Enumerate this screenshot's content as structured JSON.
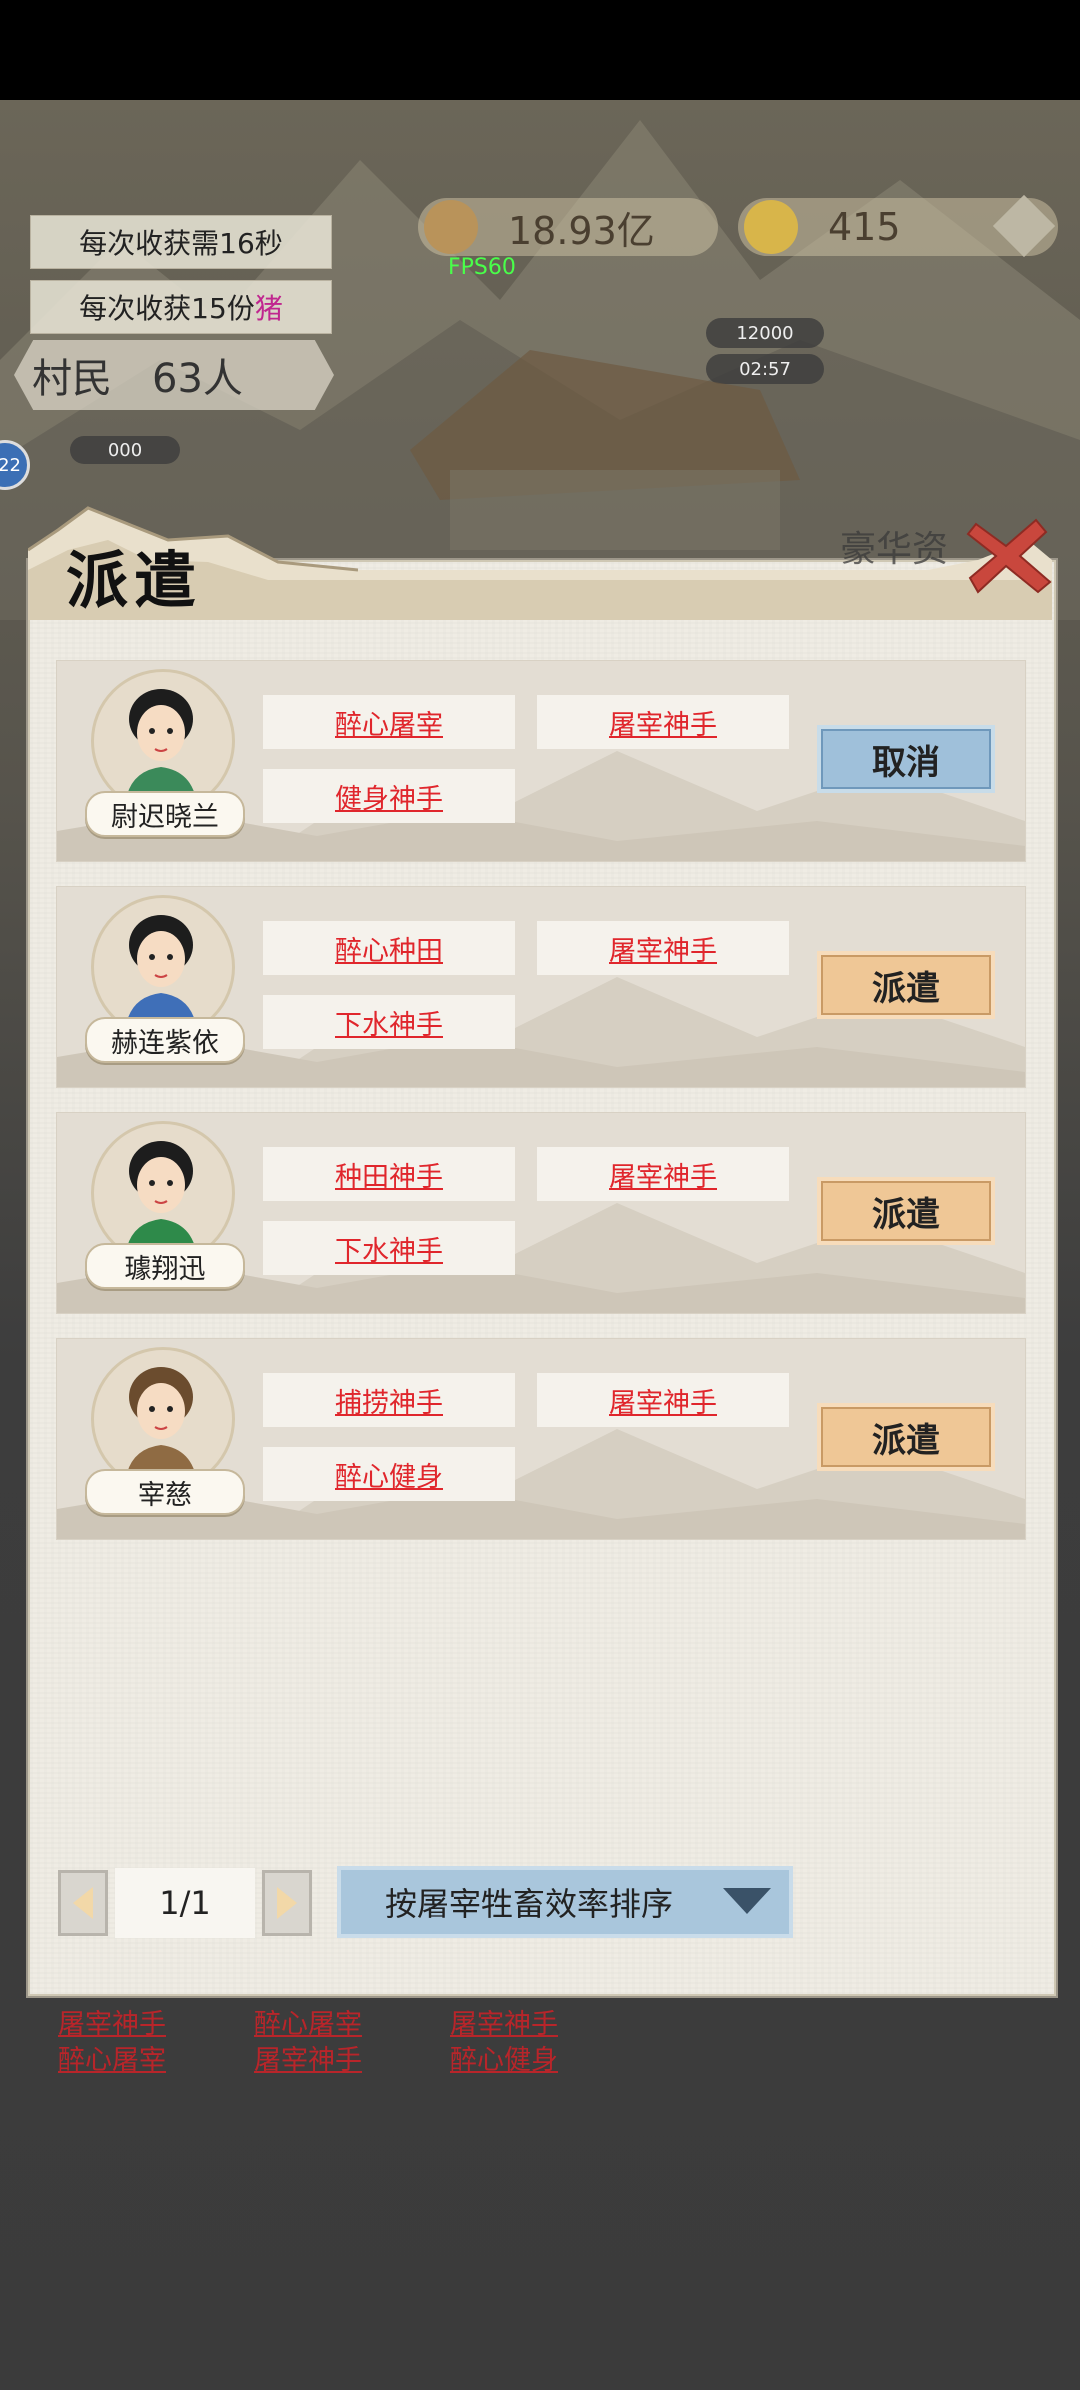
{
  "hud": {
    "harvest_time": "每次收获需16秒",
    "harvest_amount_prefix": "每次收获15份",
    "harvest_amount_item": "猪",
    "coins": "18.93亿",
    "ingots": "415",
    "fps": "FPS60",
    "villagers_label": "村民",
    "villagers_count": "63人",
    "timer_value": "12000",
    "timer_clock": "02:57",
    "side_badge": "22",
    "side_value": "000"
  },
  "panel": {
    "title": "派遣",
    "header_right_text": "豪华资"
  },
  "villagers": [
    {
      "name": "尉迟晓兰",
      "traits": [
        "醉心屠宰",
        "屠宰神手",
        "健身神手"
      ],
      "action": "取消",
      "action_type": "cancel"
    },
    {
      "name": "赫连紫依",
      "traits": [
        "醉心种田",
        "屠宰神手",
        "下水神手"
      ],
      "action": "派遣",
      "action_type": "dispatch"
    },
    {
      "name": "璩翔迅",
      "traits": [
        "种田神手",
        "屠宰神手",
        "下水神手"
      ],
      "action": "派遣",
      "action_type": "dispatch"
    },
    {
      "name": "宰慈",
      "traits": [
        "捕捞神手",
        "屠宰神手",
        "醉心健身"
      ],
      "action": "派遣",
      "action_type": "dispatch"
    }
  ],
  "pager": {
    "page": "1/1",
    "sort_label": "按屠宰牲畜效率排序"
  },
  "below_traits": {
    "col1": [
      "屠宰神手",
      "醉心屠宰"
    ],
    "col2": [
      "醉心屠宰",
      "屠宰神手"
    ],
    "col3": [
      "屠宰神手",
      "醉心健身"
    ]
  },
  "colors": {
    "trait_red": "#e0262c",
    "cancel_blue": "#9fc0da",
    "dispatch_orange": "#efc796"
  }
}
